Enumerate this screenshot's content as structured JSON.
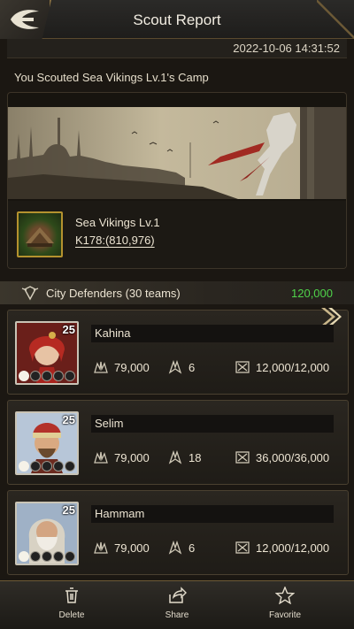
{
  "header": {
    "title": "Scout Report"
  },
  "report": {
    "date": "2022-10-06 14:31:52",
    "message": "You Scouted Sea Vikings Lv.1's Camp"
  },
  "target": {
    "name": "Sea Vikings Lv.1",
    "coords": "K178:(810,976)"
  },
  "defenders": {
    "label": "City Defenders (30 teams)",
    "power": "120,000",
    "power_color": "#4fd34a"
  },
  "troops": [
    {
      "level": "25",
      "name": "Kahina",
      "troops": "79,000",
      "stat2": "6",
      "health": "12,000/12,000"
    },
    {
      "level": "25",
      "name": "Selim",
      "troops": "79,000",
      "stat2": "18",
      "health": "36,000/36,000"
    },
    {
      "level": "25",
      "name": "Hammam",
      "troops": "79,000",
      "stat2": "6",
      "health": "12,000/12,000"
    }
  ],
  "toolbar": {
    "delete_label": "Delete",
    "share_label": "Share",
    "favorite_label": "Favorite"
  },
  "icons": {
    "back": "back-arrow-icon",
    "troops": "troops-icon",
    "power": "power-icon",
    "health": "health-icon",
    "delete": "trash-icon",
    "share": "share-icon",
    "favorite": "star-icon"
  }
}
